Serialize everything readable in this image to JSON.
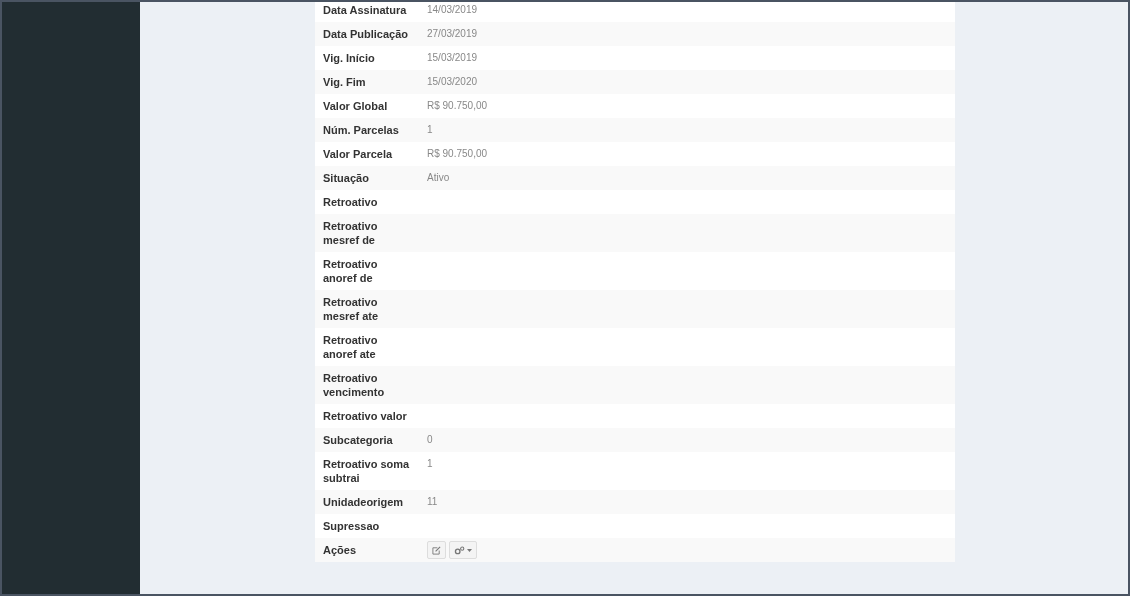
{
  "details": {
    "rows": [
      {
        "kind": "text",
        "label": "Data Assinatura",
        "value": "14/03/2019"
      },
      {
        "kind": "text",
        "label": "Data Publicação",
        "value": "27/03/2019"
      },
      {
        "kind": "text",
        "label": "Vig. Início",
        "value": "15/03/2019"
      },
      {
        "kind": "text",
        "label": "Vig. Fim",
        "value": "15/03/2020"
      },
      {
        "kind": "text",
        "label": "Valor Global",
        "value": "R$ 90.750,00"
      },
      {
        "kind": "text",
        "label": "Núm. Parcelas",
        "value": "1"
      },
      {
        "kind": "text",
        "label": "Valor Parcela",
        "value": "R$ 90.750,00"
      },
      {
        "kind": "text",
        "label": "Situação",
        "value": "Ativo"
      },
      {
        "kind": "text",
        "label": "Retroativo"
      },
      {
        "kind": "text",
        "label": "Retroativo mesref de"
      },
      {
        "kind": "text",
        "label": "Retroativo anoref de"
      },
      {
        "kind": "text",
        "label": "Retroativo mesref ate"
      },
      {
        "kind": "text",
        "label": "Retroativo anoref ate"
      },
      {
        "kind": "text",
        "label": "Retroativo vencimento"
      },
      {
        "kind": "text",
        "label": "Retroativo valor"
      },
      {
        "kind": "text",
        "label": "Subcategoria",
        "value": "0"
      },
      {
        "kind": "text",
        "label": "Retroativo soma subtrai",
        "value": "1"
      },
      {
        "kind": "text",
        "label": "Unidadeorigem",
        "value": "11"
      },
      {
        "kind": "text",
        "label": "Supressao"
      },
      {
        "kind": "actions",
        "label": "Ações"
      }
    ]
  }
}
